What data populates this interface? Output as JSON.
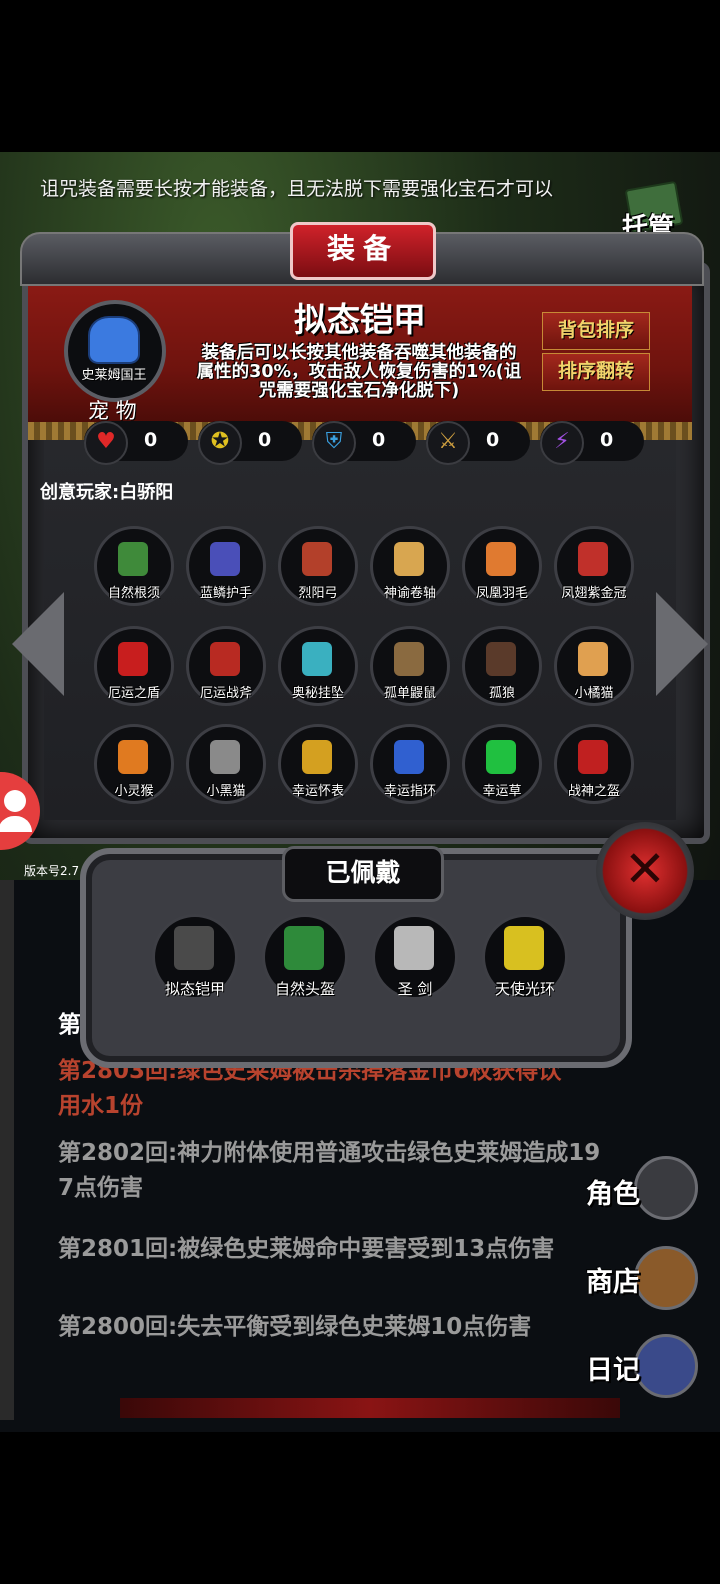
{
  "notice": "诅咒装备需要长按才能装备，且无法脱下需要强化宝石才可以",
  "auto_label": "托管",
  "panel_title": "装备",
  "item": {
    "name": "拟态铠甲",
    "desc_line1": "装备后可以长按其他装备吞噬其他装备的",
    "desc_line2": "属性的30%，攻击敌人恢复伤害的1%(诅",
    "desc_line3": "咒需要强化宝石净化脱下)"
  },
  "buttons": {
    "sort": "背包排序",
    "flip": "排序翻转"
  },
  "pet": {
    "name": "史莱姆国王",
    "label": "宠 物"
  },
  "stats": [
    {
      "icon": "heart-icon",
      "value": "0"
    },
    {
      "icon": "strength-icon",
      "value": "0"
    },
    {
      "icon": "armor-icon",
      "value": "0"
    },
    {
      "icon": "weapon-icon",
      "value": "0"
    },
    {
      "icon": "lightning-icon",
      "value": "0"
    }
  ],
  "creator": "创意玩家:白骄阳",
  "inventory": [
    {
      "label": "自然根须",
      "color": "#3f8a3a"
    },
    {
      "label": "蓝鳞护手",
      "color": "#4a4fb8"
    },
    {
      "label": "烈阳弓",
      "color": "#b3402a"
    },
    {
      "label": "神谕卷轴",
      "color": "#d8a650"
    },
    {
      "label": "凤凰羽毛",
      "color": "#e07a30"
    },
    {
      "label": "凤翅紫金冠",
      "color": "#c0302a"
    },
    {
      "label": "厄运之盾",
      "color": "#c81e1e"
    },
    {
      "label": "厄运战斧",
      "color": "#b82a22"
    },
    {
      "label": "奥秘挂坠",
      "color": "#3ab0c0"
    },
    {
      "label": "孤单鼹鼠",
      "color": "#8a6a40"
    },
    {
      "label": "孤狼",
      "color": "#5a3a2a"
    },
    {
      "label": "小橘猫",
      "color": "#e0a050"
    },
    {
      "label": "小灵猴",
      "color": "#e07a20"
    },
    {
      "label": "小黑猫",
      "color": "#8a8a8a"
    },
    {
      "label": "幸运怀表",
      "color": "#d4a020"
    },
    {
      "label": "幸运指环",
      "color": "#3060d0"
    },
    {
      "label": "幸运草",
      "color": "#20c040"
    },
    {
      "label": "战神之盔",
      "color": "#c02020"
    }
  ],
  "equipped_title": "已佩戴",
  "equipped": [
    {
      "label": "拟态铠甲",
      "color": "#4a4a4a"
    },
    {
      "label": "自然头盔",
      "color": "#2e8a3a"
    },
    {
      "label": "圣  剑",
      "color": "#b8b8b8"
    },
    {
      "label": "天使光环",
      "color": "#d8c020"
    }
  ],
  "version": "版本号2.7",
  "log": {
    "partial": "第",
    "red_line1": "第2803回:绿色史莱姆被击杀掉落金币6枚获得饮",
    "red_line2": "用水1份",
    "l2802_1": "第2802回:神力附体使用普通攻击绿色史莱姆造成19",
    "l2802_2": "7点伤害",
    "l2801": "第2801回:被绿色史莱姆命中要害受到13点伤害",
    "l2800": "第2800回:失去平衡受到绿色史莱姆10点伤害"
  },
  "menu": {
    "role": "角色",
    "shop": "商店",
    "diary": "日记"
  },
  "colors": {
    "accent_red": "#c0222a",
    "gold_text": "#f1d36b",
    "log_red": "#b8432e"
  }
}
